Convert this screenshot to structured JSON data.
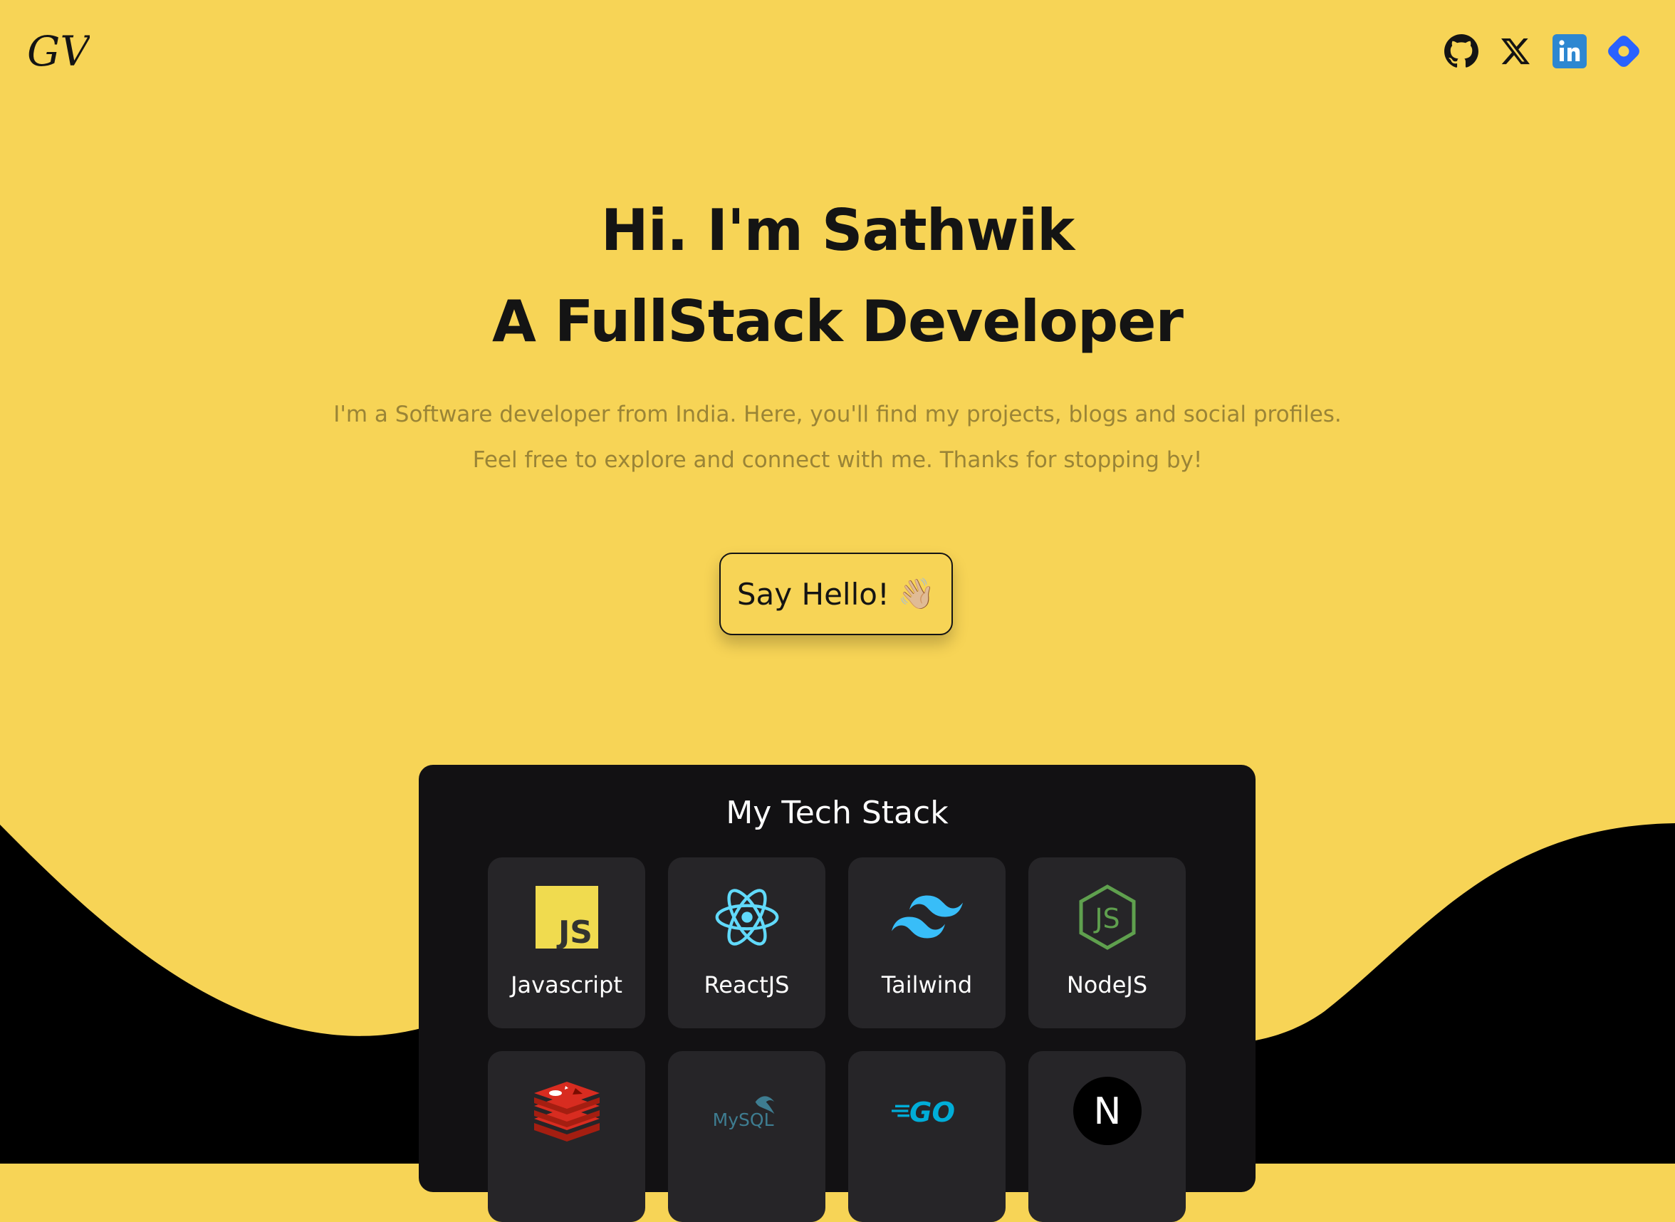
{
  "brand": {
    "logo_text": "GV"
  },
  "socials": [
    {
      "name": "github-icon"
    },
    {
      "name": "x-icon"
    },
    {
      "name": "linkedin-icon"
    },
    {
      "name": "hashnode-icon"
    }
  ],
  "hero": {
    "title_line1": "Hi. I'm Sathwik",
    "title_line2": "A FullStack Developer",
    "intro_line1": "I'm a Software developer from India. Here, you'll find my projects, blogs and social profiles.",
    "intro_line2": "Feel free to explore and connect with me. Thanks for stopping by!"
  },
  "cta": {
    "label": "Say Hello!",
    "emoji": "👋🏼"
  },
  "tech_stack": {
    "title": "My Tech Stack",
    "items": [
      {
        "label": "Javascript",
        "icon": "javascript-icon"
      },
      {
        "label": "ReactJS",
        "icon": "react-icon"
      },
      {
        "label": "Tailwind",
        "icon": "tailwind-icon"
      },
      {
        "label": "NodeJS",
        "icon": "nodejs-icon"
      },
      {
        "label": "",
        "icon": "redis-icon"
      },
      {
        "label": "",
        "icon": "mysql-icon"
      },
      {
        "label": "",
        "icon": "go-icon"
      },
      {
        "label": "",
        "icon": "nextjs-icon"
      }
    ],
    "icon_text": {
      "javascript": "JS",
      "mysql": "MySQL",
      "go": "GO",
      "nextjs": "N"
    }
  },
  "colors": {
    "background": "#f7d456",
    "wave": "#000000",
    "card": "#121113",
    "tile": "#262528",
    "text_dark": "#141414",
    "text_muted": "#9a8436",
    "linkedin": "#2d87d1",
    "hashnode": "#2962ff"
  }
}
